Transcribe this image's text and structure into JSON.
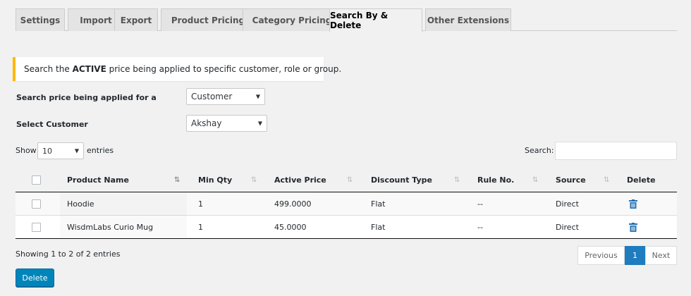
{
  "tabs": [
    {
      "label": "Settings"
    },
    {
      "label": "Import"
    },
    {
      "label": "Export"
    },
    {
      "label": "Product Pricing"
    },
    {
      "label": "Category Pricing"
    },
    {
      "label": "Search By & Delete",
      "active": true
    },
    {
      "label": "Other Extensions"
    }
  ],
  "notice": {
    "prefix": "Search the ",
    "emphasis": "ACTIVE",
    "suffix": " price being applied to specific customer, role or group.",
    "accent_color": "#ffb900"
  },
  "form": {
    "search_for_label": "Search price being applied for a",
    "search_for_value": "Customer",
    "customer_label": "Select Customer",
    "customer_value": "Akshay"
  },
  "table_controls": {
    "show_label": "Show",
    "page_length": "10",
    "entries_label": "entries",
    "search_label": "Search:",
    "search_value": ""
  },
  "table": {
    "columns": [
      "Product Name",
      "Min Qty",
      "Active Price",
      "Discount Type",
      "Rule No.",
      "Source",
      "Delete"
    ],
    "rows": [
      {
        "product": "Hoodie",
        "min_qty": "1",
        "price": "499.0000",
        "discount": "Flat",
        "rule": "--",
        "source": "Direct"
      },
      {
        "product": "WisdmLabs Curio Mug",
        "min_qty": "1",
        "price": "45.0000",
        "discount": "Flat",
        "rule": "--",
        "source": "Direct"
      }
    ]
  },
  "footer": {
    "info": "Showing 1 to 2 of 2 entries",
    "prev": "Previous",
    "current_page": "1",
    "next": "Next",
    "delete_button": "Delete",
    "button_color": "#0085ba"
  }
}
